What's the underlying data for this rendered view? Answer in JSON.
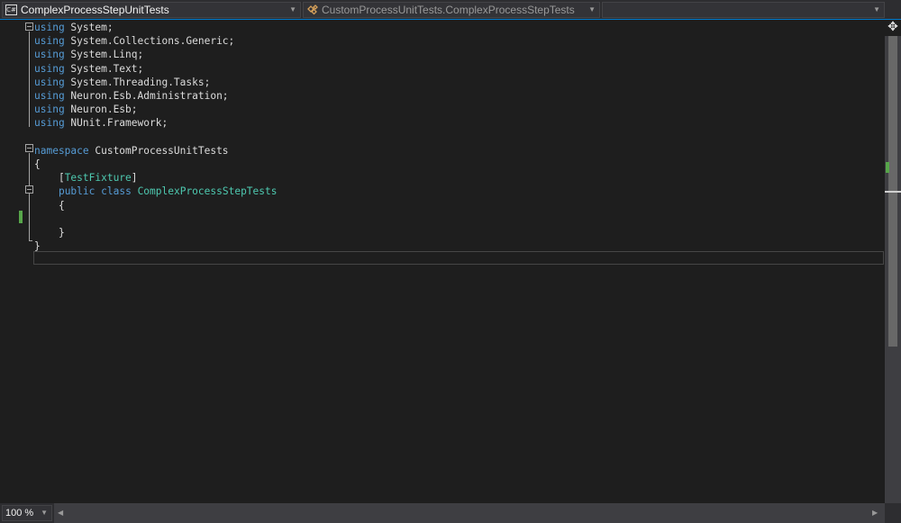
{
  "navbar": {
    "project_combo": "ComplexProcessStepUnitTests",
    "project_icon": "C#",
    "type_combo": "CustomProcessUnitTests.ComplexProcessStepTests",
    "member_combo": ""
  },
  "editor": {
    "lines": [
      [
        {
          "t": "using",
          "c": "kw"
        },
        {
          "t": " System;"
        }
      ],
      [
        {
          "t": "using",
          "c": "kw"
        },
        {
          "t": " System.Collections.Generic;"
        }
      ],
      [
        {
          "t": "using",
          "c": "kw"
        },
        {
          "t": " System.Linq;"
        }
      ],
      [
        {
          "t": "using",
          "c": "kw"
        },
        {
          "t": " System.Text;"
        }
      ],
      [
        {
          "t": "using",
          "c": "kw"
        },
        {
          "t": " System.Threading.Tasks;"
        }
      ],
      [
        {
          "t": "using",
          "c": "kw"
        },
        {
          "t": " Neuron.Esb.Administration;"
        }
      ],
      [
        {
          "t": "using",
          "c": "kw"
        },
        {
          "t": " Neuron.Esb;"
        }
      ],
      [
        {
          "t": "using",
          "c": "kw"
        },
        {
          "t": " NUnit.Framework;"
        }
      ],
      [],
      [
        {
          "t": "namespace",
          "c": "kw"
        },
        {
          "t": " CustomProcessUnitTests"
        }
      ],
      [
        {
          "t": "{"
        }
      ],
      [
        {
          "t": "    ["
        },
        {
          "t": "TestFixture",
          "c": "ty"
        },
        {
          "t": "]"
        }
      ],
      [
        {
          "t": "    "
        },
        {
          "t": "public",
          "c": "kw"
        },
        {
          "t": " "
        },
        {
          "t": "class",
          "c": "kw"
        },
        {
          "t": " "
        },
        {
          "t": "ComplexProcessStepTests",
          "c": "ty"
        }
      ],
      [
        {
          "t": "    {"
        }
      ],
      [],
      [
        {
          "t": "    }"
        }
      ],
      [
        {
          "t": "}"
        }
      ],
      []
    ]
  },
  "bottombar": {
    "zoom": "100 %"
  },
  "icons": {
    "split": "split-window-icon",
    "class": "class-icon"
  },
  "colors": {
    "keyword": "#569cd6",
    "type": "#4ec9b0",
    "text": "#dcdcdc",
    "background": "#1e1e1e",
    "change_marker": "#57a64a"
  }
}
